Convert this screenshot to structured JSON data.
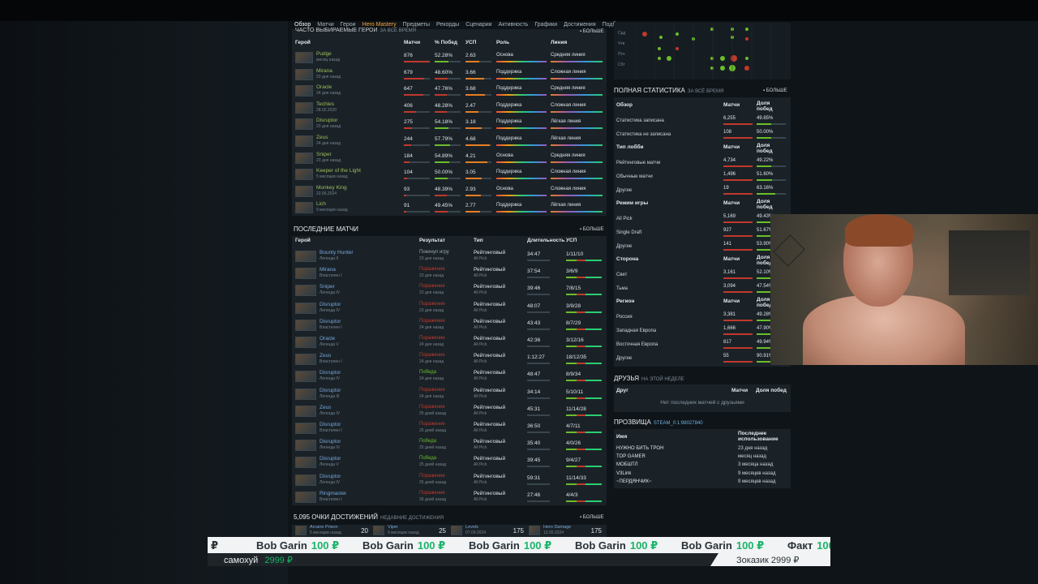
{
  "nav": [
    "Обзор",
    "Матчи",
    "Герои",
    "Hero Mastery",
    "Предметы",
    "Рекорды",
    "Сценарии",
    "Активность",
    "Графики",
    "Достижения",
    "Подборы"
  ],
  "heroes_panel": {
    "title_partial": "ЧАСТО ВЫБИРАЕМЫЕ ГЕРОИ",
    "subtitle": "ЗА ВСЁ ВРЕМЯ",
    "more": "БОЛЬШЕ",
    "headers": [
      "Герой",
      "Матчи",
      "% Побед",
      "УСП",
      "Роль",
      "Линия"
    ],
    "rows": [
      {
        "name": "Pudge",
        "time": "месяц назад",
        "matches": "876",
        "win": "52.28%",
        "kda": "2.63",
        "role": "Основа",
        "lane": "Средняя линия",
        "win_frac": 0.52
      },
      {
        "name": "Mirana",
        "time": "23 дня назад",
        "matches": "679",
        "win": "48.60%",
        "kda": "3.66",
        "role": "Поддержка",
        "lane": "Сложная линия",
        "win_frac": 0.49
      },
      {
        "name": "Oracle",
        "time": "24 дня назад",
        "matches": "647",
        "win": "47.76%",
        "kda": "3.68",
        "role": "Поддержка",
        "lane": "Средняя линия",
        "win_frac": 0.48
      },
      {
        "name": "Techies",
        "time": "28.02.2020",
        "matches": "406",
        "win": "48.28%",
        "kda": "2.47",
        "role": "Поддержка",
        "lane": "Сложная линия",
        "win_frac": 0.48
      },
      {
        "name": "Disruptor",
        "time": "23 дня назад",
        "matches": "275",
        "win": "54.18%",
        "kda": "3.18",
        "role": "Поддержка",
        "lane": "Лёгкая линия",
        "win_frac": 0.54
      },
      {
        "name": "Zeus",
        "time": "24 дня назад",
        "matches": "244",
        "win": "57.79%",
        "kda": "4.68",
        "role": "Поддержка",
        "lane": "Лёгкая линия",
        "win_frac": 0.58
      },
      {
        "name": "Sniper",
        "time": "23 дня назад",
        "matches": "184",
        "win": "54.89%",
        "kda": "4.21",
        "role": "Основа",
        "lane": "Средняя линия",
        "win_frac": 0.55
      },
      {
        "name": "Keeper of the Light",
        "time": "5 месяцев назад",
        "matches": "104",
        "win": "50.00%",
        "kda": "3.05",
        "role": "Поддержка",
        "lane": "Сложная линия",
        "win_frac": 0.5
      },
      {
        "name": "Monkey King",
        "time": "22.06.2024",
        "matches": "93",
        "win": "48.39%",
        "kda": "2.93",
        "role": "Основа",
        "lane": "Сложная линия",
        "win_frac": 0.48
      },
      {
        "name": "Lich",
        "time": "9 месяцев назад",
        "matches": "91",
        "win": "49.45%",
        "kda": "2.77",
        "role": "Поддержка",
        "lane": "Лёгкая линия",
        "win_frac": 0.49
      }
    ]
  },
  "matches_panel": {
    "title": "ПОСЛЕДНИЕ МАТЧИ",
    "more": "БОЛЬШЕ",
    "headers": [
      "Герой",
      "Результат",
      "Тип",
      "Длительность",
      "УСП"
    ],
    "rows": [
      {
        "hero": "Bounty Hunter",
        "rank": "Легенда II",
        "result": "Покинул игру",
        "rtime": "23 дня назад",
        "type": "Рейтинговый",
        "mode": "All Pick",
        "dur": "34:47",
        "kda": "1/11/10",
        "won": null
      },
      {
        "hero": "Mirana",
        "rank": "Властелин I",
        "result": "Поражение",
        "rtime": "23 дня назад",
        "type": "Рейтинговый",
        "mode": "All Pick",
        "dur": "37:54",
        "kda": "3/6/9",
        "won": false
      },
      {
        "hero": "Sniper",
        "rank": "Легенда IV",
        "result": "Поражение",
        "rtime": "23 дня назад",
        "type": "Рейтинговый",
        "mode": "All Pick",
        "dur": "39:46",
        "kda": "7/8/15",
        "won": false
      },
      {
        "hero": "Disruptor",
        "rank": "Легенда IV",
        "result": "Поражение",
        "rtime": "23 дня назад",
        "type": "Рейтинговый",
        "mode": "All Pick",
        "dur": "48:07",
        "kda": "3/9/28",
        "won": false
      },
      {
        "hero": "Disruptor",
        "rank": "Властелин I",
        "result": "Поражение",
        "rtime": "24 дня назад",
        "type": "Рейтинговый",
        "mode": "All Pick",
        "dur": "43:43",
        "kda": "8/7/29",
        "won": false
      },
      {
        "hero": "Oracle",
        "rank": "Легенда V",
        "result": "Поражение",
        "rtime": "24 дня назад",
        "type": "Рейтинговый",
        "mode": "All Pick",
        "dur": "42:36",
        "kda": "3/12/16",
        "won": false
      },
      {
        "hero": "Zeus",
        "rank": "Властелин I",
        "result": "Поражение",
        "rtime": "24 дня назад",
        "type": "Рейтинговый",
        "mode": "All Pick",
        "dur": "1:12:27",
        "kda": "18/12/35",
        "won": false
      },
      {
        "hero": "Disruptor",
        "rank": "Легенда IV",
        "result": "Победа",
        "rtime": "24 дня назад",
        "type": "Рейтинговый",
        "mode": "All Pick",
        "dur": "48:47",
        "kda": "8/9/34",
        "won": true
      },
      {
        "hero": "Disruptor",
        "rank": "Легенда III",
        "result": "Поражение",
        "rtime": "24 дня назад",
        "type": "Рейтинговый",
        "mode": "All Pick",
        "dur": "34:14",
        "kda": "5/10/11",
        "won": false
      },
      {
        "hero": "Zeus",
        "rank": "Легенда IV",
        "result": "Поражение",
        "rtime": "25 дней назад",
        "type": "Рейтинговый",
        "mode": "All Pick",
        "dur": "45:31",
        "kda": "11/14/28",
        "won": false
      },
      {
        "hero": "Disruptor",
        "rank": "Властелин I",
        "result": "Поражение",
        "rtime": "25 дней назад",
        "type": "Рейтинговый",
        "mode": "All Pick",
        "dur": "36:50",
        "kda": "4/7/11",
        "won": false
      },
      {
        "hero": "Disruptor",
        "rank": "Легенда IV",
        "result": "Победа",
        "rtime": "25 дней назад",
        "type": "Рейтинговый",
        "mode": "All Pick",
        "dur": "35:40",
        "kda": "4/0/26",
        "won": true
      },
      {
        "hero": "Disruptor",
        "rank": "Легенда V",
        "result": "Победа",
        "rtime": "25 дней назад",
        "type": "Рейтинговый",
        "mode": "All Pick",
        "dur": "39:45",
        "kda": "9/4/27",
        "won": true
      },
      {
        "hero": "Disruptor",
        "rank": "Легенда IV",
        "result": "Поражение",
        "rtime": "25 дней назад",
        "type": "Рейтинговый",
        "mode": "All Pick",
        "dur": "59:31",
        "kda": "11/14/33",
        "won": false
      },
      {
        "hero": "Ringmaster",
        "rank": "Властелин I",
        "result": "Поражение",
        "rtime": "26 дней назад",
        "type": "Рейтинговый",
        "mode": "All Pick",
        "dur": "27:46",
        "kda": "4/4/3",
        "won": false
      }
    ]
  },
  "achievements": {
    "title": "5,095 ОЧКИ ДОСТИЖЕНИЙ",
    "subtitle": "НЕДАВНИЕ ДОСТИЖЕНИЯ",
    "more": "БОЛЬШЕ",
    "items": [
      {
        "name": "Arcane Prison",
        "time": "5 месяцев назад",
        "pts": "20"
      },
      {
        "name": "Viper",
        "time": "9 месяцев назад",
        "pts": "25"
      },
      {
        "name": "Levels",
        "time": "07.09.2024",
        "pts": "175"
      },
      {
        "name": "Hero Damage",
        "time": "13.05.2024",
        "pts": "175"
      }
    ]
  },
  "heatmap": {
    "days": [
      "Срд",
      "Чтв",
      "Птн",
      "Сбт"
    ]
  },
  "stats_panel": {
    "title": "ПОЛНАЯ СТАТИСТИКА",
    "subtitle": "ЗА ВСЁ ВРЕМЯ",
    "more": "БОЛЬШЕ",
    "col_matches": "Матчи",
    "col_win": "Доля побед",
    "sections": [
      {
        "name": "Обзор",
        "rows": [
          {
            "label": "Статистика записана",
            "m": "6,255",
            "w": "49.85%"
          },
          {
            "label": "Статистика не записана",
            "m": "108",
            "w": "50.00%"
          }
        ]
      },
      {
        "name": "Тип лобби",
        "rows": [
          {
            "label": "Рейтинговые матчи",
            "m": "4,734",
            "w": "49.22%"
          },
          {
            "label": "Обычные матчи",
            "m": "1,496",
            "w": "51.60%"
          },
          {
            "label": "Другие",
            "m": "19",
            "w": "63.16%"
          }
        ]
      },
      {
        "name": "Режим игры",
        "rows": [
          {
            "label": "All Pick",
            "m": "5,169",
            "w": "49.43%"
          },
          {
            "label": "Single Draft",
            "m": "927",
            "w": "51.67%"
          },
          {
            "label": "Другие",
            "m": "141",
            "w": "53.90%"
          }
        ]
      },
      {
        "name": "Сторона",
        "rows": [
          {
            "label": "Свет",
            "m": "3,161",
            "w": "52.10%"
          },
          {
            "label": "Тьма",
            "m": "3,094",
            "w": "47.54%"
          }
        ]
      },
      {
        "name": "Регион",
        "rows": [
          {
            "label": "Россия",
            "m": "3,381",
            "w": "49.28%"
          },
          {
            "label": "Западная Европа",
            "m": "1,666",
            "w": "47.90%"
          },
          {
            "label": "Восточная Европа",
            "m": "817",
            "w": "49.94%"
          },
          {
            "label": "Другие",
            "m": "55",
            "w": "90.91%"
          }
        ]
      }
    ]
  },
  "friends": {
    "title": "ДРУЗЬЯ",
    "subtitle": "НА ЭТОЙ НЕДЕЛЕ",
    "headers": [
      "Друг",
      "Матчи",
      "Доля побед"
    ],
    "empty": "Нет последних матчей с друзьями"
  },
  "aliases": {
    "title": "ПРОЗВИЩА",
    "steam": "STEAM_0:1:98027840",
    "headers": [
      "Имя",
      "Последнее использование"
    ],
    "rows": [
      {
        "name": "НУЖНО БИТЬ ТРОН",
        "time": "23 дня назад"
      },
      {
        "name": "TOP GAMER",
        "time": "месяц назад"
      },
      {
        "name": "МОБШТЛ",
        "time": "3 месяца назад"
      },
      {
        "name": "V3Link",
        "time": "9 месяцев назад"
      },
      {
        "name": "~ПЕРДЯНЧИК~",
        "time": "9 месяцев назад"
      }
    ]
  },
  "ticker": {
    "items": [
      {
        "name": "₽",
        "amt": ""
      },
      {
        "name": "Bob Garin",
        "amt": "100 ₽"
      },
      {
        "name": "Bob Garin",
        "amt": "100 ₽"
      },
      {
        "name": "Bob Garin",
        "amt": "100 ₽"
      },
      {
        "name": "Bob Garin",
        "amt": "100 ₽"
      },
      {
        "name": "Bob Garin",
        "amt": "100 ₽"
      },
      {
        "name": "Факт",
        "amt": "100"
      }
    ],
    "left_name": "самохуй",
    "left_amt": "2999 ₽",
    "right_text": "Зоказик 2999 ₽"
  }
}
